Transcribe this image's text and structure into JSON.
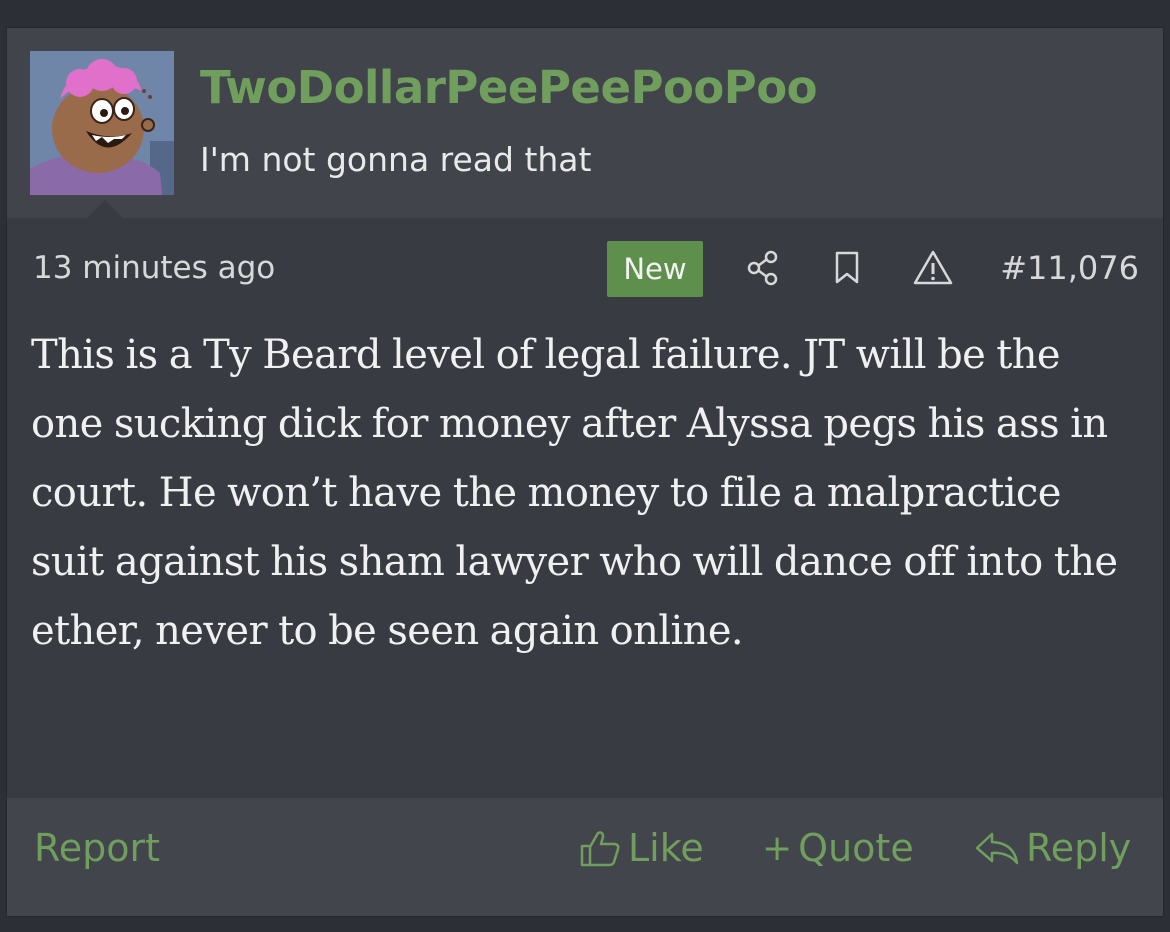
{
  "post": {
    "username": "TwoDollarPeePeePooPoo",
    "user_title": "I'm not gonna read that",
    "timestamp": "13 minutes ago",
    "new_badge": "New",
    "post_number": "#11,076",
    "body": "This is a Ty Beard level of legal failure. JT will be the one sucking dick for money after Alyssa pegs his ass in court. He won’t have the money to file a malpractice suit against his sham lawyer who will dance off into the ether, never to be seen again online.",
    "icons": [
      "share-icon",
      "bookmark-icon",
      "warning-icon"
    ]
  },
  "footer": {
    "report_label": "Report",
    "like_label": "Like",
    "quote_label": "Quote",
    "reply_label": "Reply"
  },
  "colors": {
    "accent_green": "#6f9e5d",
    "badge_green": "#5e8f4d",
    "post_background": "#383b42",
    "header_background": "#41444b"
  }
}
